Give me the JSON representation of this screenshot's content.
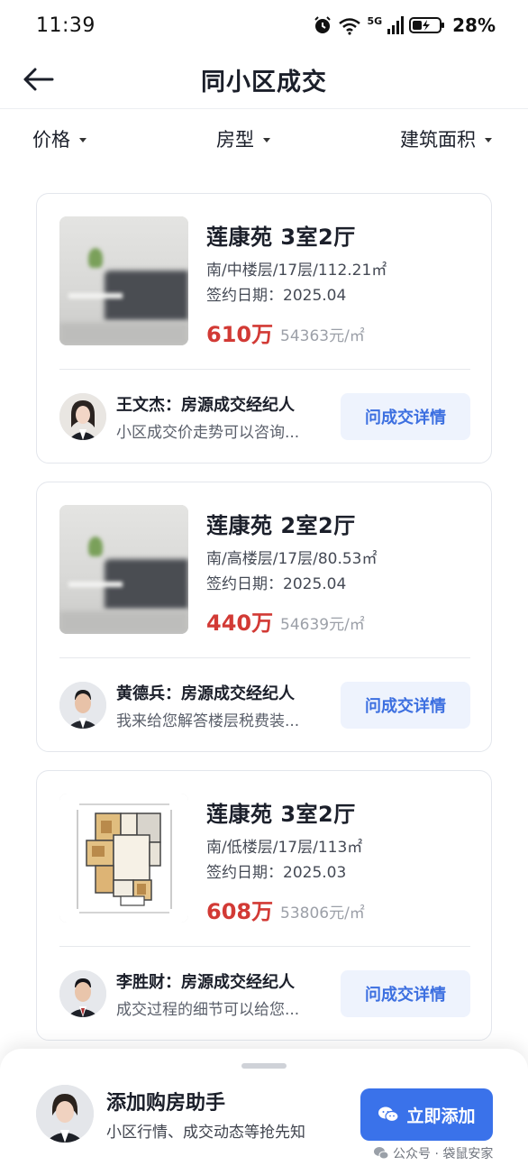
{
  "status_bar": {
    "time": "11:39",
    "network": "5G",
    "battery": "28%"
  },
  "nav": {
    "title": "同小区成交"
  },
  "filters": [
    {
      "label": "价格"
    },
    {
      "label": "房型"
    },
    {
      "label": "建筑面积"
    }
  ],
  "listings": [
    {
      "title": "莲康苑 3室2厅",
      "spec": "南/中楼层/17层/112.21㎡",
      "date": "签约日期：2025.04",
      "price": "610万",
      "unit_price": "54363元/㎡",
      "image": "living-room-photo",
      "agent_name": "王文杰：房源成交经纪人",
      "agent_msg": "小区成交价走势可以咨询...",
      "button": "问成交详情"
    },
    {
      "title": "莲康苑 2室2厅",
      "spec": "南/高楼层/17层/80.53㎡",
      "date": "签约日期：2025.04",
      "price": "440万",
      "unit_price": "54639元/㎡",
      "image": "living-room-photo",
      "agent_name": "黄德兵：房源成交经纪人",
      "agent_msg": "我来给您解答楼层税费装...",
      "button": "问成交详情"
    },
    {
      "title": "莲康苑 3室2厅",
      "spec": "南/低楼层/17层/113㎡",
      "date": "签约日期：2025.03",
      "price": "608万",
      "unit_price": "53806元/㎡",
      "image": "floor-plan",
      "agent_name": "李胜财：房源成交经纪人",
      "agent_msg": "成交过程的细节可以给您...",
      "button": "问成交详情"
    }
  ],
  "bottom_sheet": {
    "title": "添加购房助手",
    "subtitle": "小区行情、成交动态等抢先知",
    "button": "立即添加",
    "watermark": "公众号 · 袋鼠安家"
  },
  "colors": {
    "price": "#d23a35",
    "accent": "#3a72ea",
    "ask_button_bg": "#eef3fd"
  }
}
